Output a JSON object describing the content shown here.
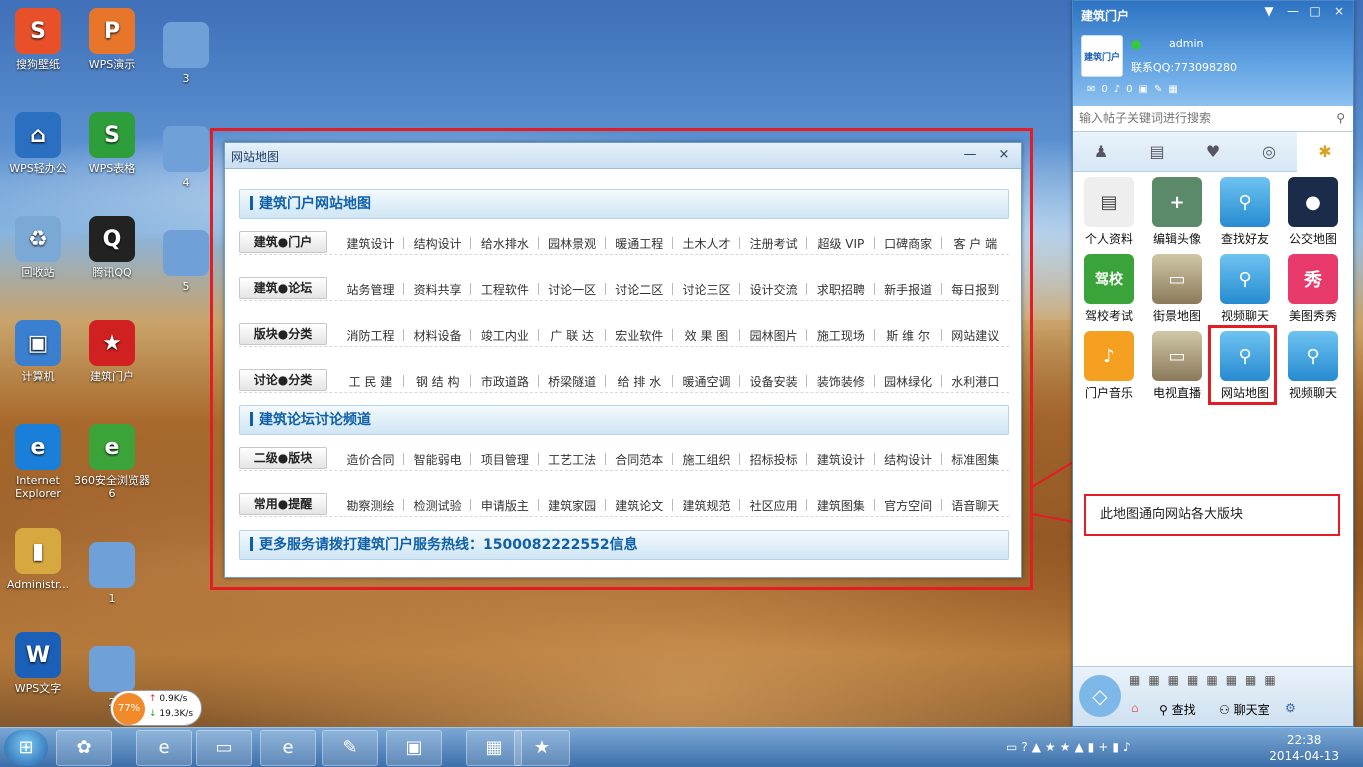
{
  "desktop_icons": [
    {
      "label": "搜狗壁纸",
      "glyph": "S",
      "color": "#e8502a"
    },
    {
      "label": "WPS演示",
      "glyph": "P",
      "color": "#e8762a"
    },
    {
      "label": "3",
      "glyph": "",
      "color": "#6fa0d8"
    },
    {
      "label": "WPS轻办公",
      "glyph": "⌂",
      "color": "#2a6fc0"
    },
    {
      "label": "WPS表格",
      "glyph": "S",
      "color": "#2e9e3a"
    },
    {
      "label": "4",
      "glyph": "",
      "color": "#6fa0d8"
    },
    {
      "label": "回收站",
      "glyph": "♻",
      "color": "#7aa9d6"
    },
    {
      "label": "腾讯QQ",
      "glyph": "Q",
      "color": "#222222"
    },
    {
      "label": "5",
      "glyph": "",
      "color": "#6fa0d8"
    },
    {
      "label": "计算机",
      "glyph": "▣",
      "color": "#3a7fd0"
    },
    {
      "label": "建筑门户",
      "glyph": "★",
      "color": "#d02020"
    },
    {
      "label": "Internet Explorer",
      "glyph": "e",
      "color": "#1a7fd8"
    },
    {
      "label": "360安全浏览器6",
      "glyph": "e",
      "color": "#3aa43a"
    },
    {
      "label": "Administr...",
      "glyph": "▮",
      "color": "#d8a840"
    },
    {
      "label": "1",
      "glyph": "",
      "color": "#6fa0d8"
    },
    {
      "label": "WPS文字",
      "glyph": "W",
      "color": "#1a5fb8"
    },
    {
      "label": "2",
      "glyph": "",
      "color": "#6fa0d8"
    }
  ],
  "netmeter": {
    "percent": "77%",
    "up": "0.9K/s",
    "down": "19.3K/s"
  },
  "sitemap": {
    "title": "网站地图",
    "min": "—",
    "close": "×",
    "section1": "建筑门户网站地图",
    "section2": "建筑论坛讨论频道",
    "footer": "更多服务请拨打建筑门户服务热线：1500082222552信息",
    "rows1": [
      {
        "cat": "建筑●门户",
        "links": [
          "建筑设计",
          "结构设计",
          "给水排水",
          "园林景观",
          "暖通工程",
          "土木人才",
          "注册考试",
          "超级 VIP",
          "口碑商家",
          "客 户 端"
        ]
      },
      {
        "cat": "建筑●论坛",
        "links": [
          "站务管理",
          "资料共享",
          "工程软件",
          "讨论一区",
          "讨论二区",
          "讨论三区",
          "设计交流",
          "求职招聘",
          "新手报道",
          "每日报到"
        ]
      },
      {
        "cat": "版块●分类",
        "links": [
          "消防工程",
          "材料设备",
          "竣工内业",
          "广 联 达",
          "宏业软件",
          "效 果 图",
          "园林图片",
          "施工现场",
          "斯 维 尔",
          "网站建议"
        ]
      },
      {
        "cat": "讨论●分类",
        "links": [
          "工 民 建",
          "钢 结 构",
          "市政道路",
          "桥梁隧道",
          "给 排 水",
          "暖通空调",
          "设备安装",
          "装饰装修",
          "园林绿化",
          "水利港口"
        ]
      }
    ],
    "rows2": [
      {
        "cat": "二级●版块",
        "links": [
          "造价合同",
          "智能弱电",
          "项目管理",
          "工艺工法",
          "合同范本",
          "施工组织",
          "招标投标",
          "建筑设计",
          "结构设计",
          "标准图集"
        ]
      },
      {
        "cat": "常用●提醒",
        "links": [
          "勘察测绘",
          "检测试验",
          "申请版主",
          "建筑家园",
          "建筑论文",
          "建筑规范",
          "社区应用",
          "建筑图集",
          "官方空间",
          "语音聊天"
        ]
      }
    ]
  },
  "panel": {
    "title": "建筑门户",
    "ctl": [
      "▼",
      "—",
      "□",
      "×"
    ],
    "avatar_text": "建筑门户",
    "username": "admin",
    "contact": "联系QQ:773098280",
    "stat_mail": "0",
    "stat_vol": "0",
    "search_placeholder": "输入帖子关键词进行搜索",
    "apps": [
      {
        "label": "个人资料",
        "glyph": "▤",
        "cls": "",
        "bg": "#eeeeee",
        "fg": "#444"
      },
      {
        "label": "编辑头像",
        "glyph": "+",
        "cls": "",
        "bg": "#5a8a6a",
        "fg": "#fff"
      },
      {
        "label": "查找好友",
        "glyph": "⚲",
        "cls": "keyi",
        "bg": "",
        "fg": "#fff"
      },
      {
        "label": "公交地图",
        "glyph": "●",
        "cls": "",
        "bg": "#1b2b4a",
        "fg": "#fff"
      },
      {
        "label": "驾校考试",
        "glyph": "驾校",
        "cls": "",
        "bg": "#3aa43a",
        "fg": "#fff"
      },
      {
        "label": "街景地图",
        "glyph": "▭",
        "cls": "tvi",
        "bg": "",
        "fg": "#fff"
      },
      {
        "label": "视频聊天",
        "glyph": "⚲",
        "cls": "keyi",
        "bg": "",
        "fg": "#fff"
      },
      {
        "label": "美图秀秀",
        "glyph": "秀",
        "cls": "",
        "bg": "#e83a6a",
        "fg": "#fff"
      },
      {
        "label": "门户音乐",
        "glyph": "♪",
        "cls": "",
        "bg": "#f5a020",
        "fg": "#fff"
      },
      {
        "label": "电视直播",
        "glyph": "▭",
        "cls": "tvi",
        "bg": "",
        "fg": "#fff"
      },
      {
        "label": "网站地图",
        "glyph": "⚲",
        "cls": "keyi",
        "bg": "",
        "fg": "#fff"
      },
      {
        "label": "视频聊天",
        "glyph": "⚲",
        "cls": "keyi",
        "bg": "",
        "fg": "#fff"
      }
    ],
    "bottom_search": "查找",
    "bottom_chat": "聊天室"
  },
  "callout": "此地图通向网站各大版块",
  "clock": {
    "time": "22:38",
    "date": "2014-04-13"
  }
}
